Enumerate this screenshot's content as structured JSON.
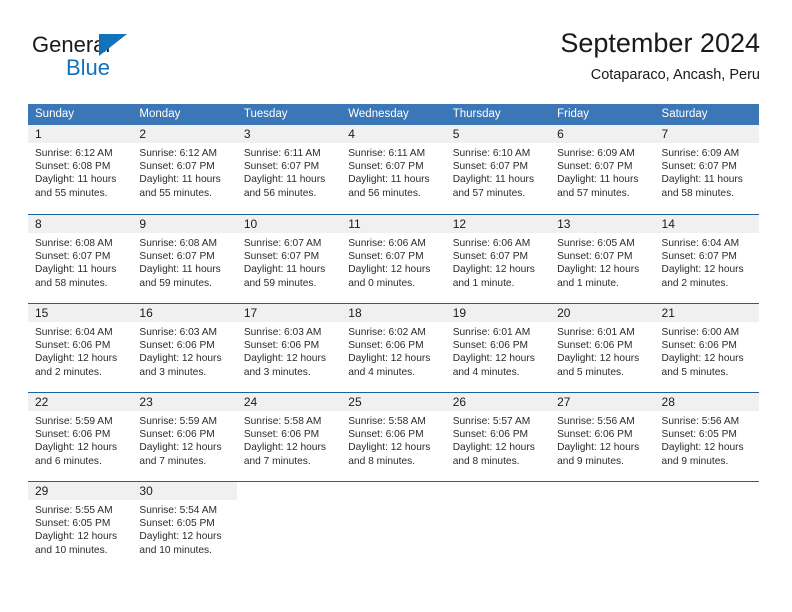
{
  "brand": {
    "word_top": "General",
    "word_bottom": "Blue",
    "triangle_icon": "triangle-icon",
    "color_blue": "#1273bd",
    "color_black": "#1a1a1a"
  },
  "header": {
    "title": "September 2024",
    "subtitle": "Cotaparaco, Ancash, Peru"
  },
  "calendar": {
    "header_bg": "#3b77b7",
    "header_text_color": "#ffffff",
    "row_divider_color": "#1f5fa0",
    "daynum_band_color": "#f0f0f0",
    "weekdays": [
      "Sunday",
      "Monday",
      "Tuesday",
      "Wednesday",
      "Thursday",
      "Friday",
      "Saturday"
    ],
    "weeks": [
      [
        {
          "day": "1",
          "sunrise": "Sunrise: 6:12 AM",
          "sunset": "Sunset: 6:08 PM",
          "daylight": "Daylight: 11 hours and 55 minutes."
        },
        {
          "day": "2",
          "sunrise": "Sunrise: 6:12 AM",
          "sunset": "Sunset: 6:07 PM",
          "daylight": "Daylight: 11 hours and 55 minutes."
        },
        {
          "day": "3",
          "sunrise": "Sunrise: 6:11 AM",
          "sunset": "Sunset: 6:07 PM",
          "daylight": "Daylight: 11 hours and 56 minutes."
        },
        {
          "day": "4",
          "sunrise": "Sunrise: 6:11 AM",
          "sunset": "Sunset: 6:07 PM",
          "daylight": "Daylight: 11 hours and 56 minutes."
        },
        {
          "day": "5",
          "sunrise": "Sunrise: 6:10 AM",
          "sunset": "Sunset: 6:07 PM",
          "daylight": "Daylight: 11 hours and 57 minutes."
        },
        {
          "day": "6",
          "sunrise": "Sunrise: 6:09 AM",
          "sunset": "Sunset: 6:07 PM",
          "daylight": "Daylight: 11 hours and 57 minutes."
        },
        {
          "day": "7",
          "sunrise": "Sunrise: 6:09 AM",
          "sunset": "Sunset: 6:07 PM",
          "daylight": "Daylight: 11 hours and 58 minutes."
        }
      ],
      [
        {
          "day": "8",
          "sunrise": "Sunrise: 6:08 AM",
          "sunset": "Sunset: 6:07 PM",
          "daylight": "Daylight: 11 hours and 58 minutes."
        },
        {
          "day": "9",
          "sunrise": "Sunrise: 6:08 AM",
          "sunset": "Sunset: 6:07 PM",
          "daylight": "Daylight: 11 hours and 59 minutes."
        },
        {
          "day": "10",
          "sunrise": "Sunrise: 6:07 AM",
          "sunset": "Sunset: 6:07 PM",
          "daylight": "Daylight: 11 hours and 59 minutes."
        },
        {
          "day": "11",
          "sunrise": "Sunrise: 6:06 AM",
          "sunset": "Sunset: 6:07 PM",
          "daylight": "Daylight: 12 hours and 0 minutes."
        },
        {
          "day": "12",
          "sunrise": "Sunrise: 6:06 AM",
          "sunset": "Sunset: 6:07 PM",
          "daylight": "Daylight: 12 hours and 1 minute."
        },
        {
          "day": "13",
          "sunrise": "Sunrise: 6:05 AM",
          "sunset": "Sunset: 6:07 PM",
          "daylight": "Daylight: 12 hours and 1 minute."
        },
        {
          "day": "14",
          "sunrise": "Sunrise: 6:04 AM",
          "sunset": "Sunset: 6:07 PM",
          "daylight": "Daylight: 12 hours and 2 minutes."
        }
      ],
      [
        {
          "day": "15",
          "sunrise": "Sunrise: 6:04 AM",
          "sunset": "Sunset: 6:06 PM",
          "daylight": "Daylight: 12 hours and 2 minutes."
        },
        {
          "day": "16",
          "sunrise": "Sunrise: 6:03 AM",
          "sunset": "Sunset: 6:06 PM",
          "daylight": "Daylight: 12 hours and 3 minutes."
        },
        {
          "day": "17",
          "sunrise": "Sunrise: 6:03 AM",
          "sunset": "Sunset: 6:06 PM",
          "daylight": "Daylight: 12 hours and 3 minutes."
        },
        {
          "day": "18",
          "sunrise": "Sunrise: 6:02 AM",
          "sunset": "Sunset: 6:06 PM",
          "daylight": "Daylight: 12 hours and 4 minutes."
        },
        {
          "day": "19",
          "sunrise": "Sunrise: 6:01 AM",
          "sunset": "Sunset: 6:06 PM",
          "daylight": "Daylight: 12 hours and 4 minutes."
        },
        {
          "day": "20",
          "sunrise": "Sunrise: 6:01 AM",
          "sunset": "Sunset: 6:06 PM",
          "daylight": "Daylight: 12 hours and 5 minutes."
        },
        {
          "day": "21",
          "sunrise": "Sunrise: 6:00 AM",
          "sunset": "Sunset: 6:06 PM",
          "daylight": "Daylight: 12 hours and 5 minutes."
        }
      ],
      [
        {
          "day": "22",
          "sunrise": "Sunrise: 5:59 AM",
          "sunset": "Sunset: 6:06 PM",
          "daylight": "Daylight: 12 hours and 6 minutes."
        },
        {
          "day": "23",
          "sunrise": "Sunrise: 5:59 AM",
          "sunset": "Sunset: 6:06 PM",
          "daylight": "Daylight: 12 hours and 7 minutes."
        },
        {
          "day": "24",
          "sunrise": "Sunrise: 5:58 AM",
          "sunset": "Sunset: 6:06 PM",
          "daylight": "Daylight: 12 hours and 7 minutes."
        },
        {
          "day": "25",
          "sunrise": "Sunrise: 5:58 AM",
          "sunset": "Sunset: 6:06 PM",
          "daylight": "Daylight: 12 hours and 8 minutes."
        },
        {
          "day": "26",
          "sunrise": "Sunrise: 5:57 AM",
          "sunset": "Sunset: 6:06 PM",
          "daylight": "Daylight: 12 hours and 8 minutes."
        },
        {
          "day": "27",
          "sunrise": "Sunrise: 5:56 AM",
          "sunset": "Sunset: 6:06 PM",
          "daylight": "Daylight: 12 hours and 9 minutes."
        },
        {
          "day": "28",
          "sunrise": "Sunrise: 5:56 AM",
          "sunset": "Sunset: 6:05 PM",
          "daylight": "Daylight: 12 hours and 9 minutes."
        }
      ],
      [
        {
          "day": "29",
          "sunrise": "Sunrise: 5:55 AM",
          "sunset": "Sunset: 6:05 PM",
          "daylight": "Daylight: 12 hours and 10 minutes."
        },
        {
          "day": "30",
          "sunrise": "Sunrise: 5:54 AM",
          "sunset": "Sunset: 6:05 PM",
          "daylight": "Daylight: 12 hours and 10 minutes."
        },
        {
          "day": "",
          "sunrise": "",
          "sunset": "",
          "daylight": ""
        },
        {
          "day": "",
          "sunrise": "",
          "sunset": "",
          "daylight": ""
        },
        {
          "day": "",
          "sunrise": "",
          "sunset": "",
          "daylight": ""
        },
        {
          "day": "",
          "sunrise": "",
          "sunset": "",
          "daylight": ""
        },
        {
          "day": "",
          "sunrise": "",
          "sunset": "",
          "daylight": ""
        }
      ]
    ]
  }
}
